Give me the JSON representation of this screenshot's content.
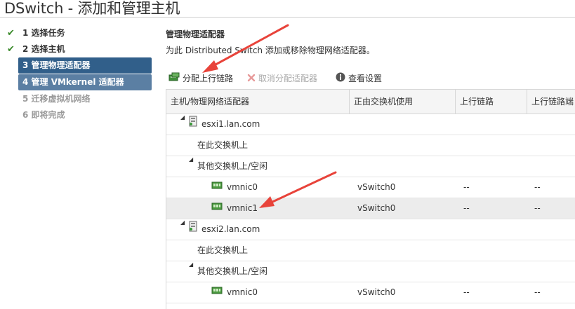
{
  "window": {
    "title": "DSwitch - 添加和管理主机"
  },
  "steps": [
    {
      "label": "1 选择任务",
      "done": true
    },
    {
      "label": "2 选择主机",
      "done": true
    },
    {
      "label": "3 管理物理适配器",
      "state": "active"
    },
    {
      "label": "4 管理 VMkernel 适配器",
      "state": "next"
    },
    {
      "label": "5 迁移虚拟机网络",
      "state": "disabled"
    },
    {
      "label": "6 即将完成",
      "state": "disabled"
    }
  ],
  "section": {
    "title": "管理物理适配器",
    "description": "为此 Distributed Switch 添加或移除物理网络适配器。"
  },
  "toolbar": {
    "assign_uplink": "分配上行链路",
    "unassign_adapter": "取消分配适配器",
    "view_settings": "查看设置"
  },
  "table": {
    "columns": [
      "主机/物理网络适配器",
      "正由交换机使用",
      "上行链路",
      "上行链路端"
    ],
    "rows": [
      {
        "type": "host",
        "label": "esxi1.lan.com"
      },
      {
        "type": "group",
        "label": "在此交换机上"
      },
      {
        "type": "group-expand",
        "label": "其他交换机上/空闲"
      },
      {
        "type": "nic",
        "label": "vmnic0",
        "switch": "vSwitch0",
        "uplink": "--",
        "uplink_port": "--"
      },
      {
        "type": "nic",
        "label": "vmnic1",
        "switch": "vSwitch0",
        "uplink": "--",
        "uplink_port": "--",
        "selected": true
      },
      {
        "type": "host",
        "label": "esxi2.lan.com"
      },
      {
        "type": "group",
        "label": "在此交换机上"
      },
      {
        "type": "group-expand",
        "label": "其他交换机上/空闲"
      },
      {
        "type": "nic",
        "label": "vmnic0",
        "switch": "vSwitch0",
        "uplink": "--",
        "uplink_port": "--"
      }
    ]
  },
  "colors": {
    "active_step": "#315f8a",
    "next_step": "#5b7fa3",
    "check": "#3a8a2a",
    "annotation_arrow": "#e8433a"
  }
}
